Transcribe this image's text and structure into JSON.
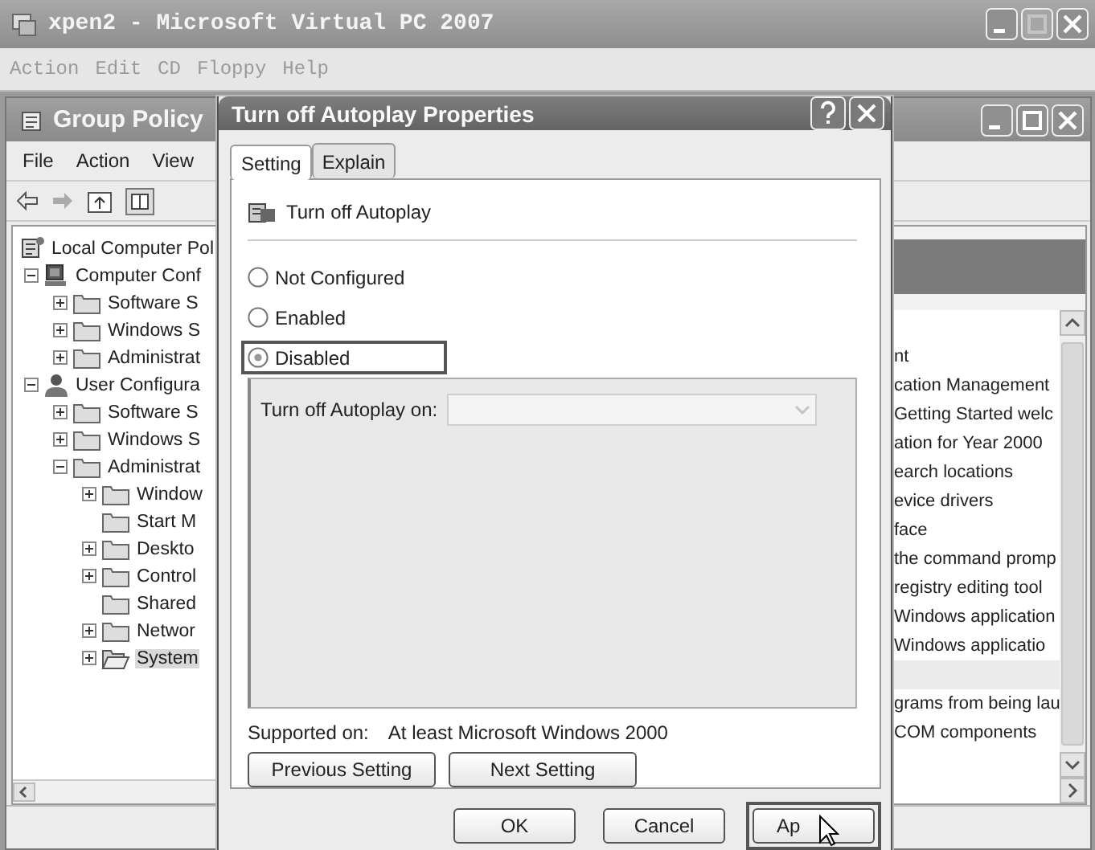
{
  "host_window": {
    "title": "xpen2 - Microsoft Virtual PC 2007",
    "menu": [
      "Action",
      "Edit",
      "CD",
      "Floppy",
      "Help"
    ]
  },
  "gp_window": {
    "title": "Group Policy",
    "menu": [
      "File",
      "Action",
      "View"
    ],
    "tree": [
      {
        "label": "Local Computer Pol",
        "kind": "root",
        "selected": false,
        "children": [
          {
            "label": "Computer Conf",
            "kind": "computer",
            "expanded": true,
            "selected": false,
            "children": [
              {
                "label": "Software S",
                "kind": "folder",
                "expanded": false,
                "selected": false
              },
              {
                "label": "Windows S",
                "kind": "folder",
                "expanded": false,
                "selected": false
              },
              {
                "label": "Administrat",
                "kind": "folder",
                "expanded": false,
                "selected": false
              }
            ]
          },
          {
            "label": "User Configura",
            "kind": "user",
            "expanded": true,
            "selected": false,
            "children": [
              {
                "label": "Software S",
                "kind": "folder",
                "expanded": false,
                "selected": false
              },
              {
                "label": "Windows S",
                "kind": "folder",
                "expanded": false,
                "selected": false
              },
              {
                "label": "Administrat",
                "kind": "folder",
                "expanded": true,
                "selected": false,
                "children": [
                  {
                    "label": "Window",
                    "kind": "folder",
                    "expanded": false,
                    "selected": false
                  },
                  {
                    "label": "Start M",
                    "kind": "folder",
                    "selected": false
                  },
                  {
                    "label": "Deskto",
                    "kind": "folder",
                    "expanded": false,
                    "selected": false
                  },
                  {
                    "label": "Control",
                    "kind": "folder",
                    "expanded": false,
                    "selected": false
                  },
                  {
                    "label": "Shared",
                    "kind": "folder",
                    "selected": false
                  },
                  {
                    "label": "Networ",
                    "kind": "folder",
                    "expanded": false,
                    "selected": false
                  },
                  {
                    "label": "System",
                    "kind": "open-folder",
                    "expanded": false,
                    "selected": true
                  }
                ]
              }
            ]
          }
        ]
      }
    ],
    "list_groups": [
      {
        "rows": [
          "nt",
          "cation Management",
          "Getting Started welc",
          "ation for Year 2000",
          "earch locations",
          "evice drivers",
          "face",
          "the command promp",
          "registry editing tool",
          "Windows application",
          "Windows applicatio"
        ]
      },
      {
        "rows": [
          "grams from being lau",
          "COM components"
        ]
      }
    ]
  },
  "dialog": {
    "title": "Turn off Autoplay Properties",
    "tabs": [
      {
        "label": "Setting",
        "selected": true
      },
      {
        "label": "Explain",
        "selected": false
      }
    ],
    "policy_name": "Turn off Autoplay",
    "options": [
      {
        "label": "Not Configured",
        "selected": false,
        "highlighted": false
      },
      {
        "label": "Enabled",
        "selected": false,
        "highlighted": false
      },
      {
        "label": "Disabled",
        "selected": true,
        "highlighted": true
      }
    ],
    "options_panel": {
      "label": "Turn off Autoplay on:",
      "disabled": true
    },
    "supported_label": "Supported on:",
    "supported_value": "At least Microsoft Windows 2000",
    "nav_buttons": [
      "Previous Setting",
      "Next Setting"
    ],
    "buttons": [
      {
        "label": "OK",
        "highlighted": false
      },
      {
        "label": "Cancel",
        "highlighted": false
      },
      {
        "label": "Ap",
        "highlighted": true
      }
    ]
  }
}
